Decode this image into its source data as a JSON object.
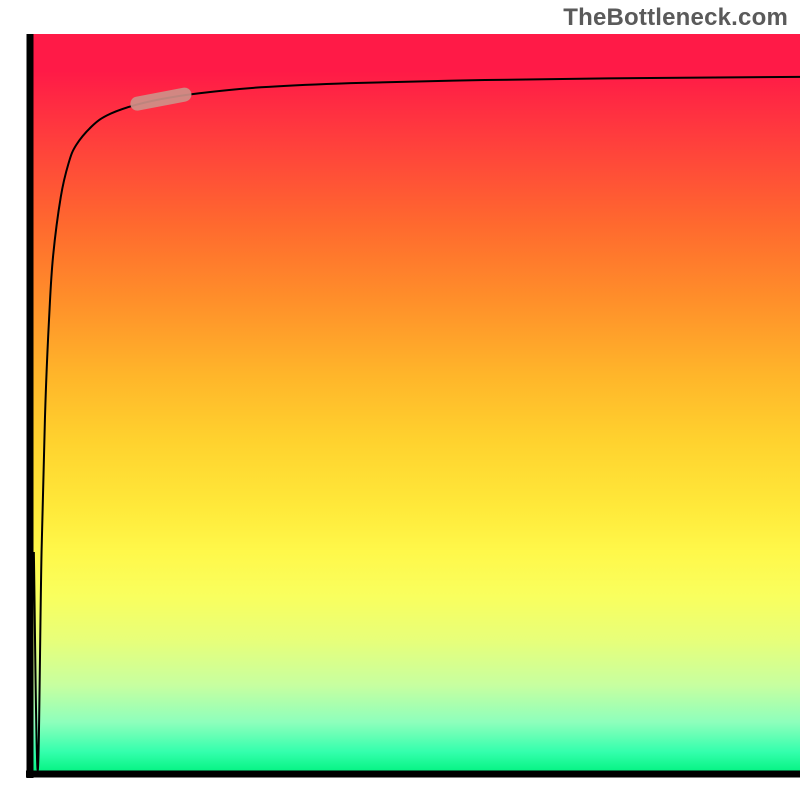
{
  "attribution": "TheBottleneck.com",
  "colors": {
    "gradient_top": "#ff1a47",
    "gradient_bottom": "#00f27e",
    "curve": "#000000",
    "axis": "#000000",
    "marker": "#cf9088",
    "attribution_text": "#5a5a5a"
  },
  "chart_data": {
    "type": "line",
    "title": "",
    "xlabel": "",
    "ylabel": "",
    "xlim": [
      0,
      100
    ],
    "ylim": [
      0,
      100
    ],
    "legend": false,
    "grid": false,
    "series": [
      {
        "name": "bottleneck-curve",
        "x": [
          0.5,
          1,
          1.5,
          2,
          2.5,
          3,
          4,
          5,
          6,
          8,
          10,
          13,
          17,
          22,
          30,
          40,
          55,
          75,
          100
        ],
        "y": [
          30,
          0.5,
          30,
          50,
          62,
          70,
          78,
          82.5,
          85,
          87.5,
          89,
          90.2,
          91.2,
          92,
          92.8,
          93.3,
          93.7,
          94,
          94.2
        ]
      }
    ],
    "annotations": [
      {
        "name": "highlight-marker",
        "x": 17,
        "y": 91.2
      }
    ]
  }
}
